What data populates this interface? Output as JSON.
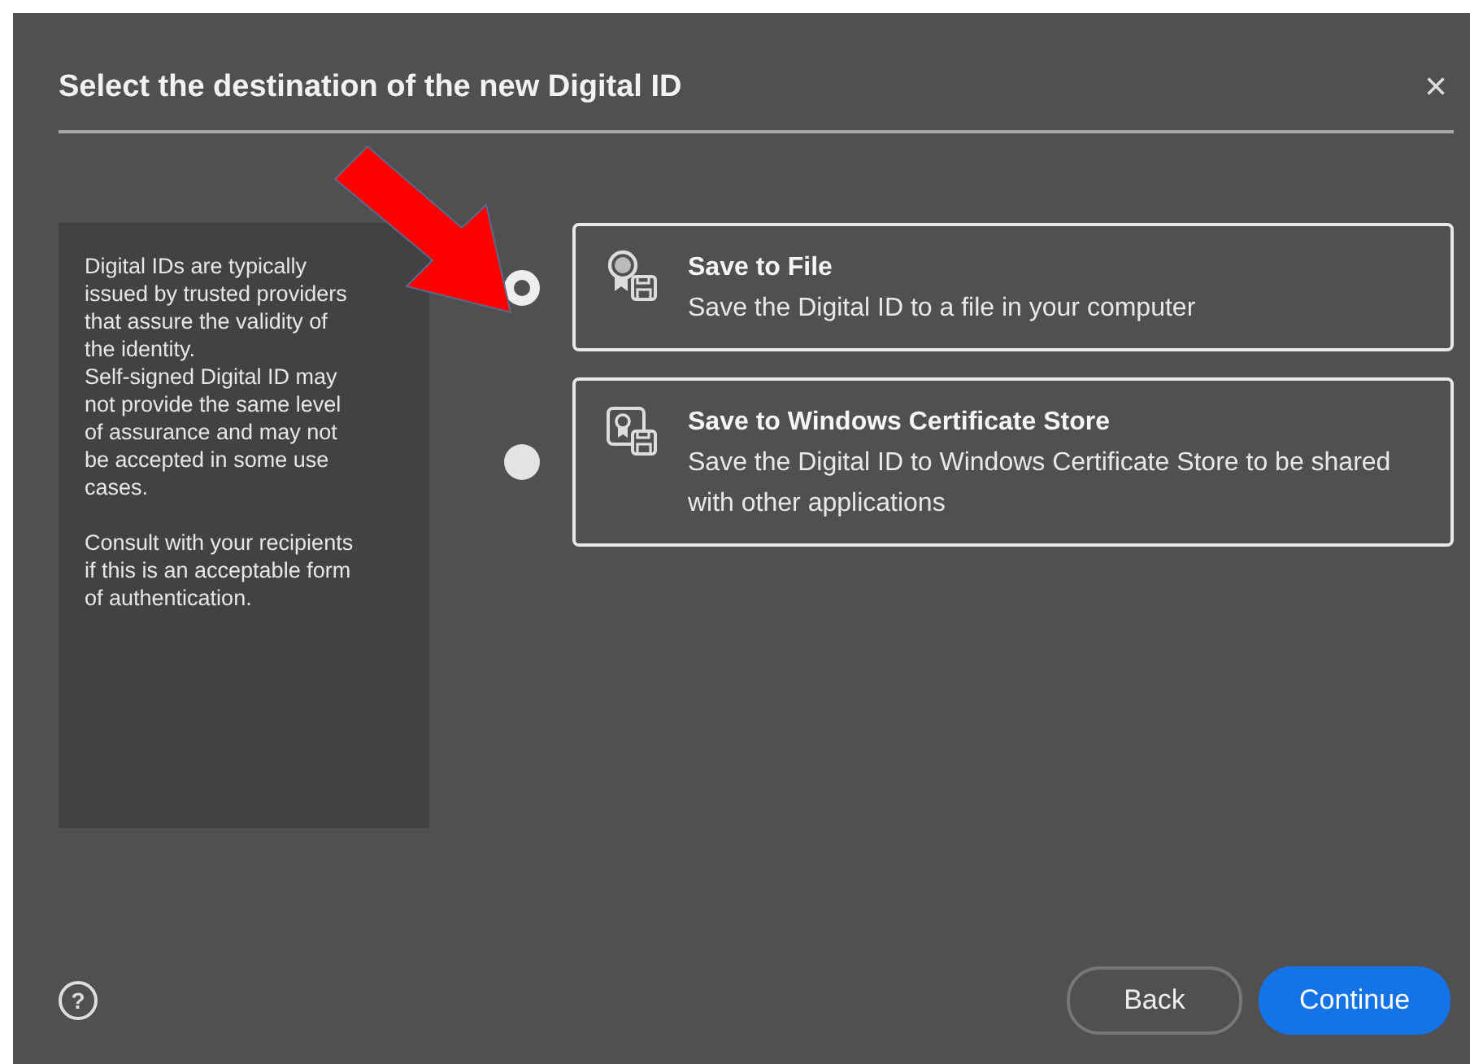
{
  "dialog": {
    "title": "Select the destination of the new Digital ID",
    "close": "×"
  },
  "info_panel": {
    "paragraphs": [
      "Digital IDs are typically issued by trusted providers that assure the validity of the identity.\nSelf-signed Digital ID may not provide the same level of assurance and may not be accepted in some use cases.",
      "Consult with your recipients if this is an acceptable form of authentication."
    ]
  },
  "options": [
    {
      "kind": "file",
      "title": "Save to File",
      "description": "Save the Digital ID to a file in your computer",
      "selected": true
    },
    {
      "kind": "store",
      "title": "Save to Windows Certificate Store",
      "description": "Save the Digital ID to Windows Certificate Store to be shared with other applications",
      "selected": false
    }
  ],
  "annotation": {
    "kind": "arrow"
  },
  "footer": {
    "help": "?",
    "buttons": [
      {
        "label": "Back",
        "kind": "secondary"
      },
      {
        "label": "Continue",
        "kind": "primary"
      }
    ]
  }
}
